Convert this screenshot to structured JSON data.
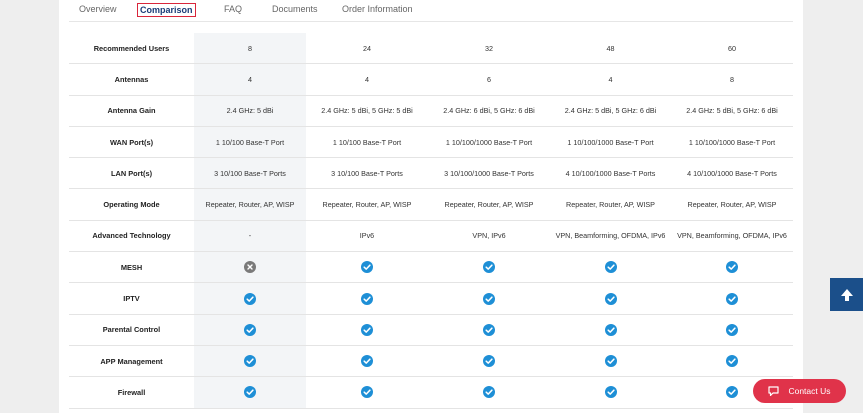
{
  "tabs": [
    {
      "label": "Overview"
    },
    {
      "label": "Comparison"
    },
    {
      "label": "FAQ"
    },
    {
      "label": "Documents"
    },
    {
      "label": "Order Information"
    }
  ],
  "rows": [
    {
      "label": "Recommended Users",
      "cells": [
        "8",
        "24",
        "32",
        "48",
        "60"
      ]
    },
    {
      "label": "Antennas",
      "cells": [
        "4",
        "4",
        "6",
        "4",
        "8"
      ]
    },
    {
      "label": "Antenna Gain",
      "cells": [
        "2.4 GHz: 5 dBi",
        "2.4 GHz: 5 dBi, 5 GHz: 5 dBi",
        "2.4 GHz: 6 dBi, 5 GHz: 6 dBi",
        "2.4 GHz: 5 dBi, 5 GHz: 6 dBi",
        "2.4 GHz: 5 dBi, 5 GHz: 6 dBi"
      ]
    },
    {
      "label": "WAN Port(s)",
      "cells": [
        "1 10/100 Base-T Port",
        "1 10/100 Base-T Port",
        "1 10/100/1000 Base-T Port",
        "1 10/100/1000 Base-T Port",
        "1 10/100/1000 Base-T Port"
      ]
    },
    {
      "label": "LAN Port(s)",
      "cells": [
        "3 10/100 Base-T Ports",
        "3 10/100 Base-T Ports",
        "3 10/100/1000 Base-T Ports",
        "4 10/100/1000 Base-T Ports",
        "4 10/100/1000 Base-T Ports"
      ]
    },
    {
      "label": "Operating Mode",
      "cells": [
        "Repeater, Router, AP, WISP",
        "Repeater, Router, AP, WISP",
        "Repeater, Router, AP, WISP",
        "Repeater, Router, AP, WISP",
        "Repeater, Router, AP, WISP"
      ]
    },
    {
      "label": "Advanced Technology",
      "cells": [
        "-",
        "IPv6",
        "VPN, IPv6",
        "VPN, Beamforming, OFDMA, IPv6",
        "VPN, Beamforming, OFDMA, IPv6"
      ]
    },
    {
      "label": "MESH",
      "icons": [
        "cross-icon",
        "check-icon",
        "check-icon",
        "check-icon",
        "check-icon"
      ]
    },
    {
      "label": "IPTV",
      "icons": [
        "check-icon",
        "check-icon",
        "check-icon",
        "check-icon",
        "check-icon"
      ]
    },
    {
      "label": "Parental Control",
      "icons": [
        "check-icon",
        "check-icon",
        "check-icon",
        "check-icon",
        "check-icon"
      ]
    },
    {
      "label": "APP Management",
      "icons": [
        "check-icon",
        "check-icon",
        "check-icon",
        "check-icon",
        "check-icon"
      ]
    },
    {
      "label": "Firewall",
      "icons": [
        "check-icon",
        "check-icon",
        "check-icon",
        "check-icon",
        "check-icon"
      ]
    }
  ],
  "floating": {
    "contact_label": "Contact Us",
    "back_to_top_icon": "arrow-up-icon",
    "contact_icon": "chat-icon"
  },
  "colors": {
    "check": "#1e8fd6",
    "cross": "#7a7a7a",
    "highlight_column": "#f3f5f7",
    "accent_red": "#e0334a",
    "nav_blue": "#1b4f8a"
  }
}
